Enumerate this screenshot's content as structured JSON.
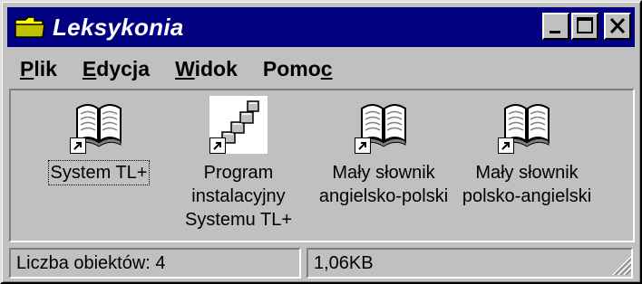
{
  "window": {
    "title": "Leksykonia"
  },
  "menu": {
    "items": [
      {
        "pre": "",
        "accel": "P",
        "post": "lik"
      },
      {
        "pre": "",
        "accel": "E",
        "post": "dycja"
      },
      {
        "pre": "",
        "accel": "W",
        "post": "idok"
      },
      {
        "pre": "Pomo",
        "accel": "c",
        "post": ""
      }
    ]
  },
  "icons": [
    {
      "label": "System TL+",
      "icon": "book-icon",
      "focused": true
    },
    {
      "label": "Program\ninstalacyjny\nSystemu TL+",
      "icon": "setup-icon",
      "focused": false
    },
    {
      "label": "Mały słownik\nangielsko-polski",
      "icon": "book-icon",
      "focused": false
    },
    {
      "label": "Mały słownik\npolsko-angielski",
      "icon": "book-icon",
      "focused": false
    }
  ],
  "statusbar": {
    "objects": "Liczba obiektów: 4",
    "size": "1,06KB"
  },
  "colors": {
    "titlebar": "#000080",
    "face": "#c0c0c0"
  }
}
